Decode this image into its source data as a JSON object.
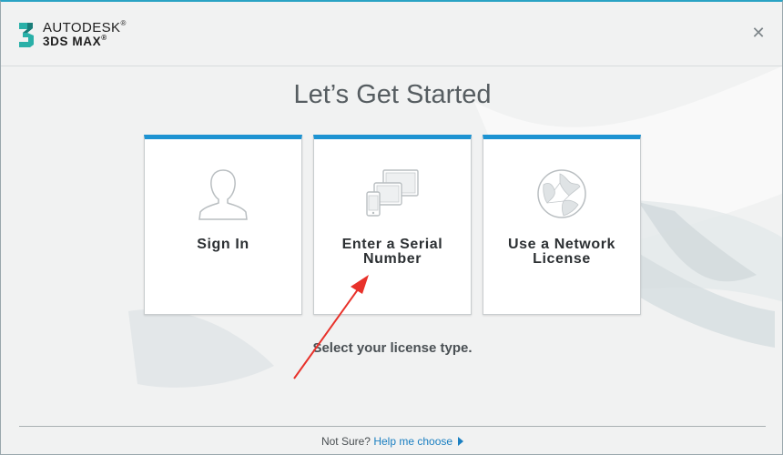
{
  "header": {
    "brand": "AUTODESK",
    "product": "3DS MAX",
    "logo_numeral": "3",
    "close_icon": "close-icon"
  },
  "main": {
    "title": "Let’s Get Started",
    "cards": [
      {
        "label_line1": "Sign In",
        "label_line2": "",
        "icon": "person-icon"
      },
      {
        "label_line1": "Enter a Serial",
        "label_line2": "Number",
        "icon": "devices-icon"
      },
      {
        "label_line1": "Use a Network",
        "label_line2": "License",
        "icon": "globe-icon"
      }
    ],
    "subtitle": "Select your license type."
  },
  "footer": {
    "prompt": "Not Sure?",
    "link": "Help me choose"
  },
  "colors": {
    "accent": "#1d93d2",
    "link": "#1a7fc1",
    "annotation_arrow": "#e8312a",
    "logo_teal": "#2ab0a8"
  }
}
